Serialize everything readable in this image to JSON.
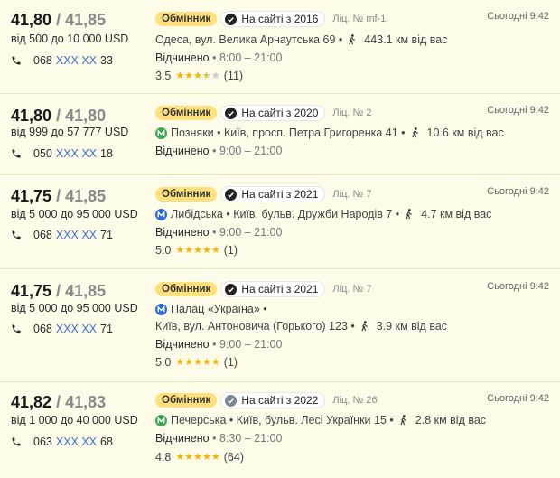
{
  "offers": [
    {
      "buy": "41,80",
      "sell": "/ 41,85",
      "range": "від 500 до 10 000 USD",
      "phone_prefix": "068",
      "phone_masked": "XXX XX",
      "phone_suffix": "33",
      "type": "Обмінник",
      "since": "На сайті з 2016",
      "license": "Ліц. № mf-1",
      "time": "Сьогодні 9:42",
      "metro": "",
      "address": "Одеса, вул. Велика Арнаутська 69 •",
      "address2": "",
      "distance": "443.1 км від вас",
      "hours_label": "Відчинено",
      "hours": "• 8:00 – 21:00",
      "rating": "3.5",
      "rating_value": 3.5,
      "reviews": "(11)"
    },
    {
      "buy": "41,80",
      "sell": "/ 41,80",
      "range": "від 999 до 57 777 USD",
      "phone_prefix": "050",
      "phone_masked": "XXX XX",
      "phone_suffix": "18",
      "type": "Обмінник",
      "since": "На сайті з 2020",
      "license": "Ліц. № 2",
      "time": "Сьогодні 9:42",
      "metro": "green",
      "address": "Позняки • Київ, просп. Петра Григоренка 41 •",
      "address2": "",
      "distance": "10.6 км від вас",
      "hours_label": "Відчинено",
      "hours": "• 9:00 – 21:00",
      "rating": "",
      "rating_value": 0,
      "reviews": ""
    },
    {
      "buy": "41,75",
      "sell": "/ 41,85",
      "range": "від 5 000 до 95 000 USD",
      "phone_prefix": "068",
      "phone_masked": "XXX XX",
      "phone_suffix": "71",
      "type": "Обмінник",
      "since": "На сайті з 2021",
      "license": "Ліц. № 7",
      "time": "Сьогодні 9:42",
      "metro": "blue",
      "address": "Либідська • Київ, бульв. Дружби Народів 7 •",
      "address2": "",
      "distance": "4.7 км від вас",
      "hours_label": "Відчинено",
      "hours": "• 9:00 – 21:00",
      "rating": "5.0",
      "rating_value": 5,
      "reviews": "(1)"
    },
    {
      "buy": "41,75",
      "sell": "/ 41,85",
      "range": "від 5 000 до 95 000 USD",
      "phone_prefix": "068",
      "phone_masked": "XXX XX",
      "phone_suffix": "71",
      "type": "Обмінник",
      "since": "На сайті з 2021",
      "license": "Ліц. № 7",
      "time": "Сьогодні 9:42",
      "metro": "blue",
      "address": "Палац «Україна» •",
      "address2": "Київ, вул. Антоновича (Горького) 123 •",
      "distance": "3.9 км від вас",
      "hours_label": "Відчинено",
      "hours": "• 9:00 – 21:00",
      "rating": "5.0",
      "rating_value": 5,
      "reviews": "(1)"
    },
    {
      "buy": "41,82",
      "sell": "/ 41,83",
      "range": "від 1 000 до 40 000 USD",
      "phone_prefix": "063",
      "phone_masked": "XXX XX",
      "phone_suffix": "68",
      "type": "Обмінник",
      "since": "На сайті з 2022",
      "license": "Ліц. № 26",
      "time": "Сьогодні 9:42",
      "metro": "green",
      "address": "Печерська • Київ, бульв. Лесі Українки 15 •",
      "address2": "",
      "distance": "2.8 км від вас",
      "hours_label": "Відчинено",
      "hours": "• 8:30 – 21:00",
      "rating": "4.8",
      "rating_value": 4.8,
      "reviews": "(64)"
    }
  ],
  "colors": {
    "metro_green": "#3aa757",
    "metro_blue": "#2b6bd6",
    "star": "#f5b400",
    "check_dark": "#222222",
    "check_light": "#7a8591"
  }
}
